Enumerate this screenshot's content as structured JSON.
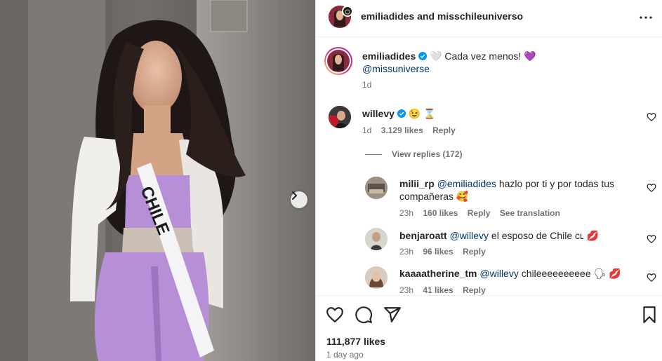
{
  "header": {
    "names": "emiliadides and misschileuniverso"
  },
  "caption": {
    "username": "emiliadides",
    "text": "Cada vez menos!",
    "emoji_1": "🤍",
    "emoji_2": "💜",
    "mention": "@missuniverse",
    "time": "1d"
  },
  "comments": [
    {
      "username": "willevy",
      "text": "😉 ⌛",
      "time": "1d",
      "likes": "3.129 likes",
      "reply": "Reply",
      "view_replies": "View replies (172)"
    }
  ],
  "replies": [
    {
      "username": "milii_rp",
      "mention": "@emiliadides",
      "text": "hazlo por ti y por todas tus",
      "text_line2": "compañeras 🥰",
      "time": "23h",
      "likes": "160 likes",
      "reply": "Reply",
      "translate": "See translation"
    },
    {
      "username": "benjaroatt",
      "mention": "@willevy",
      "text": "el esposo de Chile cʟ 💋",
      "time": "23h",
      "likes": "96 likes",
      "reply": "Reply"
    },
    {
      "username": "kaaaatherine_tm",
      "mention": "@willevy",
      "text": "chileeeeeeeeee 🗣 💋",
      "time": "23h",
      "likes": "41 likes",
      "reply": "Reply"
    }
  ],
  "footer": {
    "likes": "111,877 likes",
    "ago": "1 day ago"
  },
  "photo": {
    "sash_text": "CHILE"
  },
  "colors": {
    "verified": "#0095f6",
    "mention": "#00376b",
    "secondary": "#737373",
    "outfit": "#b78fd6",
    "story_ring": "#d62976"
  }
}
